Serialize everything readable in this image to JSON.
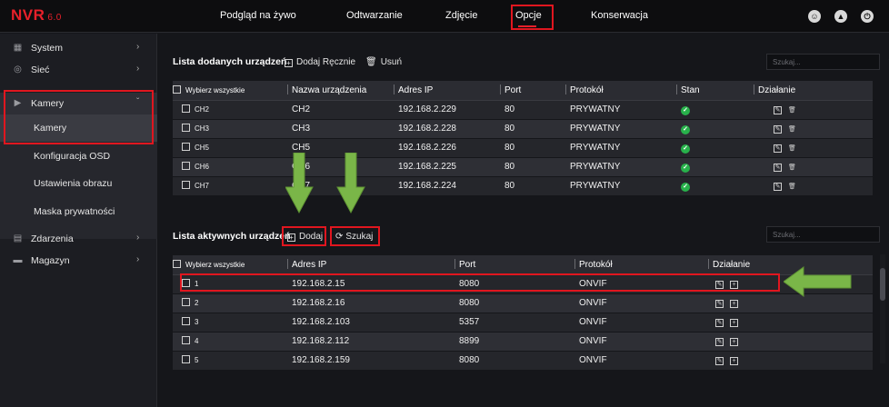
{
  "app": {
    "logo": "NVR",
    "version": "6.0"
  },
  "topnav": {
    "items": [
      "Podgląd na żywo",
      "Odtwarzanie",
      "Zdjęcie",
      "Opcje",
      "Konserwacja"
    ],
    "active": "Opcje",
    "icons": [
      "user-icon",
      "cloud-icon",
      "power-icon"
    ]
  },
  "sidebar": {
    "items": [
      {
        "label": "System",
        "icon": "system-icon"
      },
      {
        "label": "Sieć",
        "icon": "network-icon"
      },
      {
        "label": "Kamery",
        "icon": "camera-icon"
      },
      {
        "label": "Zdarzenia",
        "icon": "events-icon"
      },
      {
        "label": "Magazyn",
        "icon": "storage-icon"
      }
    ],
    "submenu": [
      "Kamery",
      "Konfiguracja OSD",
      "Ustawienia obrazu",
      "Maska prywatności"
    ],
    "active_sub": "Kamery"
  },
  "added": {
    "title": "Lista dodanych urządzeń",
    "add_manual": "Dodaj Ręcznie",
    "delete": "Usuń",
    "search_placeholder": "Szukaj...",
    "headers": [
      "Wybierz wszystkie",
      "Nazwa urządzenia",
      "Adres IP",
      "Port",
      "Protokół",
      "Stan",
      "Działanie"
    ],
    "rows": [
      {
        "ch": "CH2",
        "name": "CH2",
        "ip": "192.168.2.229",
        "port": "80",
        "protocol": "PRYWATNY"
      },
      {
        "ch": "CH3",
        "name": "CH3",
        "ip": "192.168.2.228",
        "port": "80",
        "protocol": "PRYWATNY"
      },
      {
        "ch": "CH5",
        "name": "CH5",
        "ip": "192.168.2.226",
        "port": "80",
        "protocol": "PRYWATNY"
      },
      {
        "ch": "CH6",
        "name": "CH6",
        "ip": "192.168.2.225",
        "port": "80",
        "protocol": "PRYWATNY"
      },
      {
        "ch": "CH7",
        "name": "CH7",
        "ip": "192.168.2.224",
        "port": "80",
        "protocol": "PRYWATNY"
      }
    ]
  },
  "active": {
    "title": "Lista aktywnych urządzeń",
    "add": "Dodaj",
    "search": "Szukaj",
    "search_placeholder": "Szukaj...",
    "headers": [
      "Wybierz wszystkie",
      "Adres IP",
      "Port",
      "Protokół",
      "Działanie"
    ],
    "rows": [
      {
        "n": "1",
        "ip": "192.168.2.15",
        "port": "8080",
        "protocol": "ONVIF"
      },
      {
        "n": "2",
        "ip": "192.168.2.16",
        "port": "8080",
        "protocol": "ONVIF"
      },
      {
        "n": "3",
        "ip": "192.168.2.103",
        "port": "5357",
        "protocol": "ONVIF"
      },
      {
        "n": "4",
        "ip": "192.168.2.112",
        "port": "8899",
        "protocol": "ONVIF"
      },
      {
        "n": "5",
        "ip": "192.168.2.159",
        "port": "8080",
        "protocol": "ONVIF"
      }
    ]
  },
  "colors": {
    "accent": "#e8202a",
    "annotation_arrow": "#7ab648",
    "ok": "#28b14b"
  }
}
